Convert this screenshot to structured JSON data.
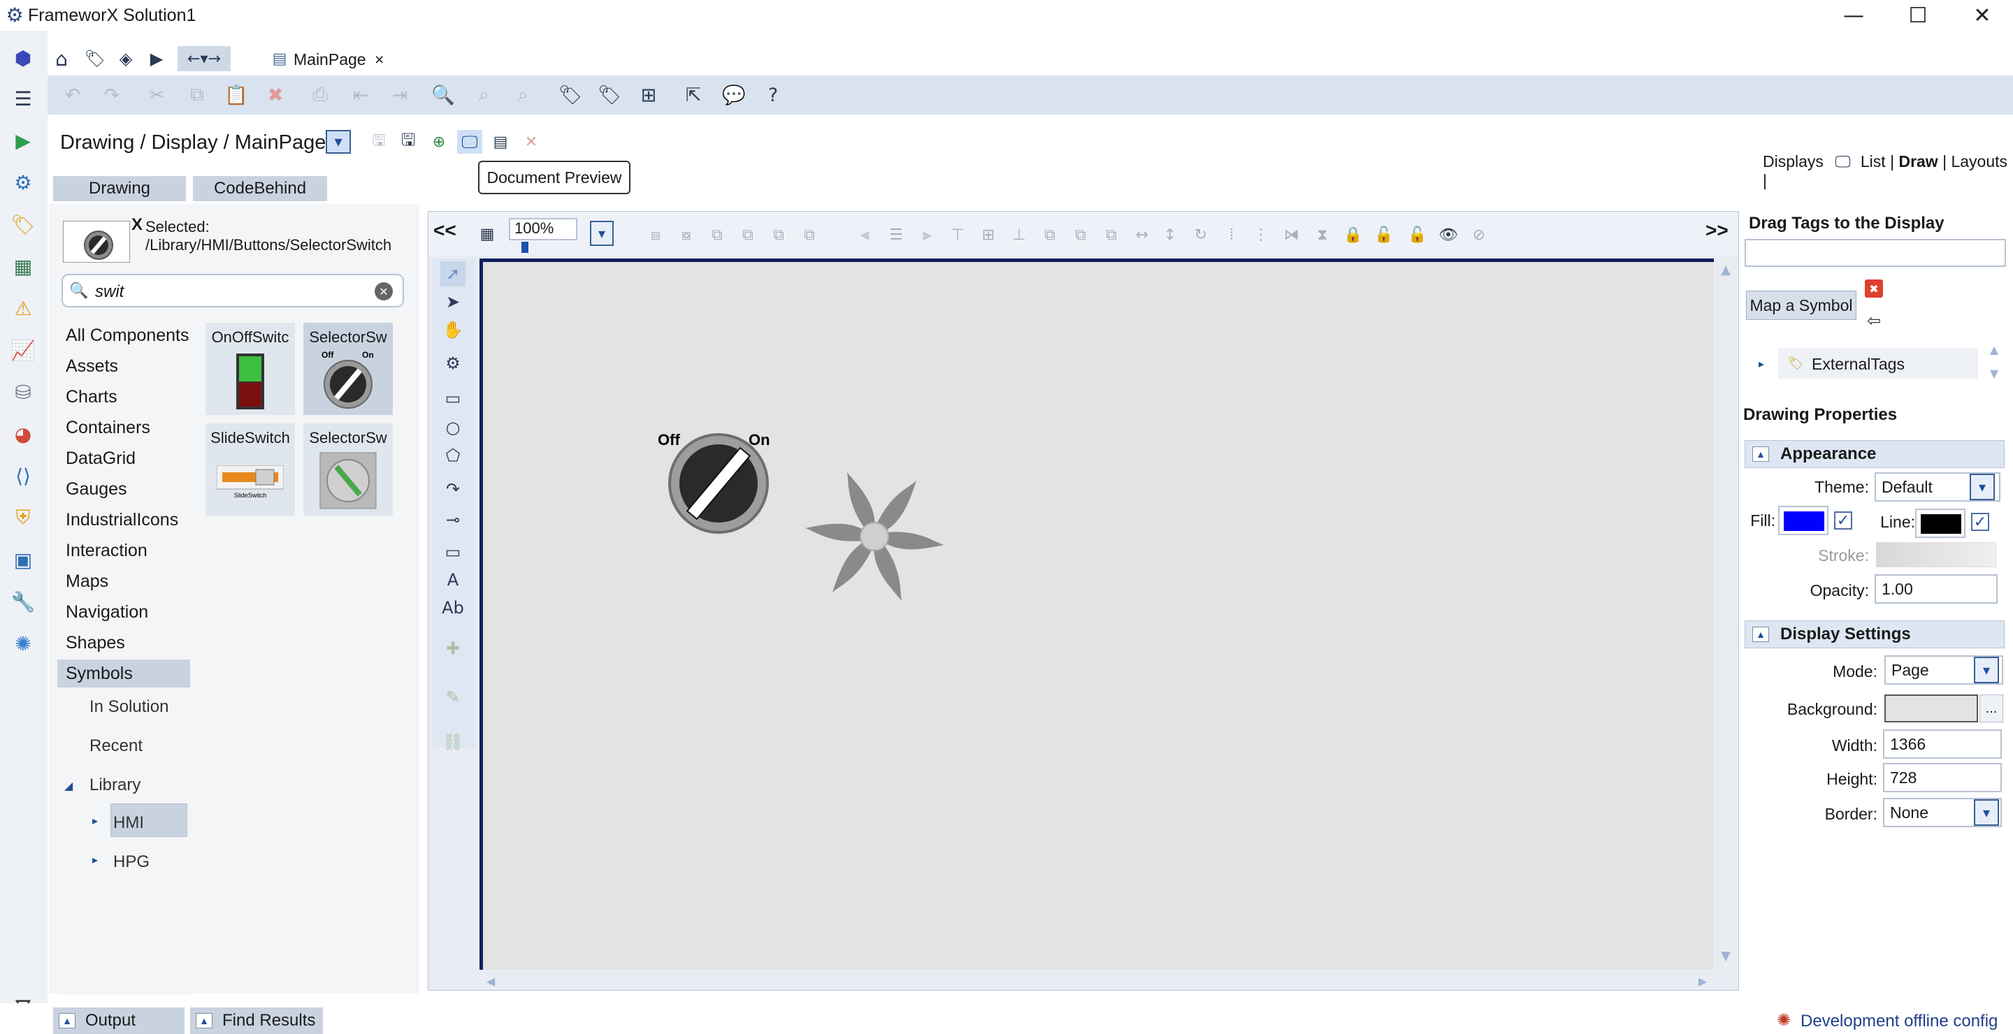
{
  "window": {
    "title": "FrameworX Solution1",
    "minimize_glyph": "—",
    "maximize_glyph": "☐",
    "close_glyph": "✕"
  },
  "tab": {
    "label": "MainPage",
    "close_glyph": "×"
  },
  "breadcrumb": {
    "path": "Drawing / Display / MainPage"
  },
  "tooltip": {
    "text": "Document Preview"
  },
  "display_links": {
    "prefix": "Displays",
    "list": "List",
    "draw": "Draw",
    "layouts": "Layouts",
    "sep": "|"
  },
  "subtabs": {
    "drawing": "Drawing",
    "codebehind": "CodeBehind"
  },
  "selection": {
    "x_label": "X",
    "label": "Selected:",
    "path": "/Library/HMI/Buttons/SelectorSwitch"
  },
  "search": {
    "value": "swit"
  },
  "categories": [
    "All Components",
    "Assets",
    "Charts",
    "Containers",
    "DataGrid",
    "Gauges",
    "IndustrialIcons",
    "Interaction",
    "Maps",
    "Navigation",
    "Shapes",
    "Symbols"
  ],
  "symbols_sub": {
    "in_solution": "In Solution",
    "recent": "Recent",
    "library": "Library",
    "hmi": "HMI",
    "hpg": "HPG"
  },
  "thumbnails": [
    {
      "label": "OnOffSwitc"
    },
    {
      "label": "SelectorSw"
    },
    {
      "label": "SlideSwitch"
    },
    {
      "label": "SelectorSw"
    }
  ],
  "thumb_text": {
    "off": "Off",
    "on": "On",
    "slide": "SlideSwitch"
  },
  "canvas": {
    "zoom": "100%",
    "collapse_left": "<<",
    "collapse_right": ">>",
    "switch_off": "Off",
    "switch_on": "On"
  },
  "right": {
    "drag_title": "Drag Tags to the Display",
    "map_symbol": "Map a Symbol",
    "tree_item": "ExternalTags",
    "drawing_props": "Drawing Properties",
    "appearance": "Appearance",
    "theme_label": "Theme:",
    "theme_value": "Default",
    "fill_label": "Fill:",
    "line_label": "Line:",
    "stroke_label": "Stroke:",
    "opacity_label": "Opacity:",
    "opacity_value": "1.00",
    "display_settings": "Display Settings",
    "mode_label": "Mode:",
    "mode_value": "Page",
    "background_label": "Background:",
    "background_btn": "...",
    "width_label": "Width:",
    "width_value": "1366",
    "height_label": "Height:",
    "height_value": "728",
    "border_label": "Border:",
    "border_value": "None",
    "fill_color": "#0000ff",
    "line_color": "#000000",
    "background_color": "#e3e3e3"
  },
  "bottom": {
    "output": "Output",
    "find_results": "Find Results",
    "status": "Development offline config"
  },
  "colors": {
    "accent": "#2f6fb8",
    "toolbar": "#d9e3f0",
    "canvas_border": "#0d1f5e"
  }
}
